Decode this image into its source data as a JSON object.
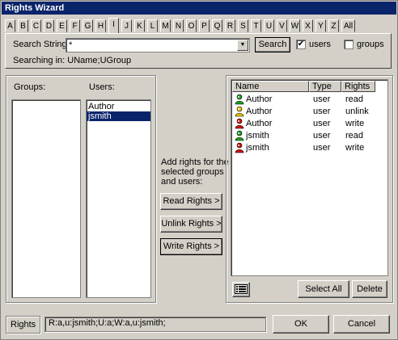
{
  "window": {
    "title": "Rights Wizard"
  },
  "letter_tabs": [
    "A",
    "B",
    "C",
    "D",
    "E",
    "F",
    "G",
    "H",
    "I",
    "J",
    "K",
    "L",
    "M",
    "N",
    "O",
    "P",
    "Q",
    "R",
    "S",
    "T",
    "U",
    "V",
    "W",
    "X",
    "Y",
    "Z",
    "All"
  ],
  "selected_letter": "I",
  "search": {
    "label": "Search String:",
    "value": "*",
    "button": "Search",
    "users_label": "users",
    "users_checked": true,
    "groups_label": "groups",
    "groups_checked": false,
    "searching_in": "Searching in: UName;UGroup"
  },
  "groups_panel": {
    "label": "Groups:",
    "items": []
  },
  "users_panel": {
    "label": "Users:",
    "items": [
      "Author",
      "jsmith"
    ],
    "selected": "jsmith"
  },
  "actions": {
    "caption": "Add rights for the selected groups and users:",
    "read": "Read Rights >",
    "unlink": "Unlink Rights >",
    "write": "Write Rights >"
  },
  "rights_table": {
    "columns": [
      "Name",
      "Type",
      "Rights"
    ],
    "rows": [
      {
        "name": "Author",
        "type": "user",
        "rights": "read",
        "icon": "user-read-icon"
      },
      {
        "name": "Author",
        "type": "user",
        "rights": "unlink",
        "icon": "user-unlink-icon"
      },
      {
        "name": "Author",
        "type": "user",
        "rights": "write",
        "icon": "user-write-icon"
      },
      {
        "name": "jsmith",
        "type": "user",
        "rights": "read",
        "icon": "user-read-icon"
      },
      {
        "name": "jsmith",
        "type": "user",
        "rights": "write",
        "icon": "user-write-icon"
      }
    ],
    "select_all": "Select All",
    "delete": "Delete",
    "view_icon": "list-view-icon"
  },
  "footer": {
    "rights_label": "Rights",
    "rights_value": "R:a,u:jsmith;U:a;W:a,u:jsmith;",
    "ok": "OK",
    "cancel": "Cancel"
  },
  "colors": {
    "title_bar": "#0a246a",
    "face": "#d4d0c8",
    "selection": "#0a246a"
  }
}
